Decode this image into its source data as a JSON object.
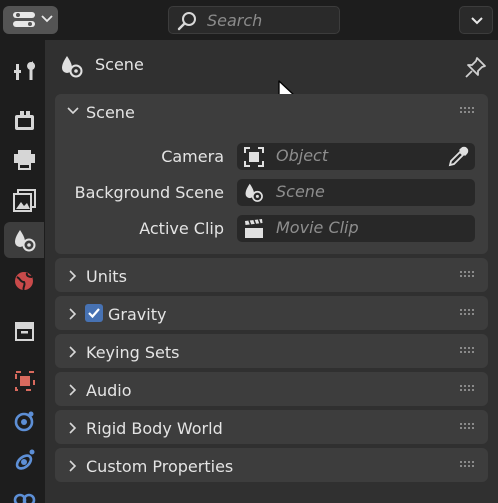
{
  "header": {
    "search_placeholder": "Search"
  },
  "tabs": [
    {
      "name": "tool-tab",
      "icon": "tool-icon"
    },
    {
      "name": "render-tab",
      "icon": "render-icon"
    },
    {
      "name": "output-tab",
      "icon": "output-icon"
    },
    {
      "name": "view-layer-tab",
      "icon": "view-layer-icon"
    },
    {
      "name": "scene-tab",
      "icon": "scene-icon",
      "active": true
    },
    {
      "name": "world-tab",
      "icon": "world-icon"
    },
    {
      "name": "collection-tab",
      "icon": "collection-icon"
    },
    {
      "name": "object-tab",
      "icon": "object-icon"
    },
    {
      "name": "modifier-tab",
      "icon": "modifier-icon"
    },
    {
      "name": "particles-tab",
      "icon": "particles-icon"
    },
    {
      "name": "physics-tab",
      "icon": "physics-icon"
    }
  ],
  "context": {
    "title": "Scene"
  },
  "scene_panel": {
    "title": "Scene",
    "expanded": true,
    "fields": [
      {
        "label": "Camera",
        "placeholder": "Object",
        "icon": "object-box-icon",
        "eyedropper": true
      },
      {
        "label": "Background Scene",
        "placeholder": "Scene",
        "icon": "scene-icon",
        "eyedropper": false
      },
      {
        "label": "Active Clip",
        "placeholder": "Movie Clip",
        "icon": "clapperboard-icon",
        "eyedropper": false
      }
    ]
  },
  "collapsed_panels": [
    {
      "title": "Units",
      "checkbox": false
    },
    {
      "title": "Gravity",
      "checkbox": true,
      "checked": true
    },
    {
      "title": "Keying Sets",
      "checkbox": false
    },
    {
      "title": "Audio",
      "checkbox": false
    },
    {
      "title": "Rigid Body World",
      "checkbox": false
    },
    {
      "title": "Custom Properties",
      "checkbox": false
    }
  ],
  "colors": {
    "accent_blue": "#4772b3",
    "world_red": "#c94a4a",
    "object_orange": "#d96a5e",
    "modifier_blue": "#5d8fd6"
  }
}
